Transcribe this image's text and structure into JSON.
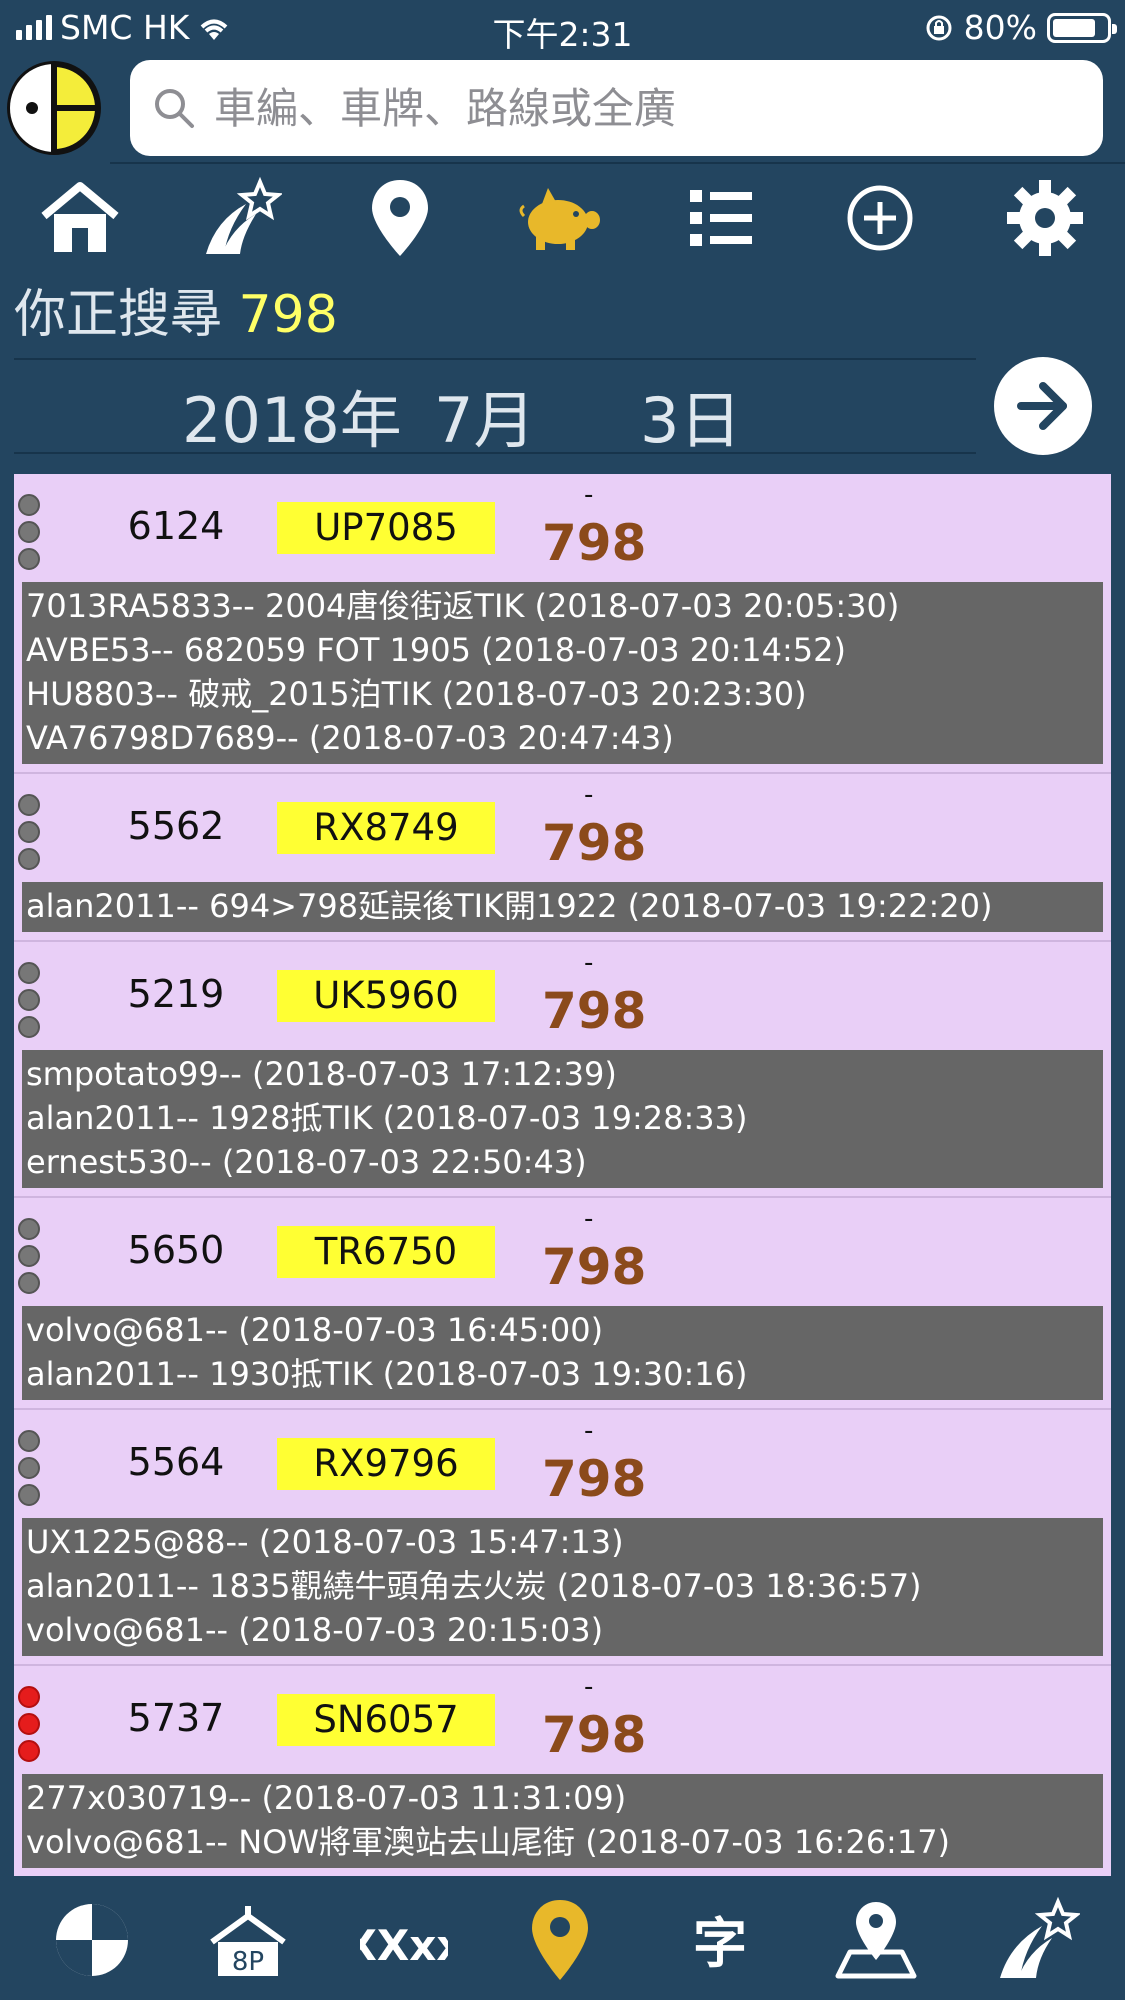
{
  "status_bar": {
    "carrier": "SMC HK",
    "time": "下午2:31",
    "battery": "80%",
    "battery_level": 0.8
  },
  "search": {
    "placeholder": "車編、車牌、路線或全廣"
  },
  "nav": {
    "icons": [
      "home-icon",
      "shooting-star-icon",
      "location-pin-icon",
      "pig-icon",
      "list-icon",
      "add-circle-icon",
      "gear-icon"
    ],
    "active": "pig-icon",
    "active_color": "#e8b82a"
  },
  "searching": {
    "label": "你正搜尋",
    "query": "798"
  },
  "date": {
    "year": "2018年",
    "month": "7月",
    "day": "3日"
  },
  "records": [
    {
      "fleet": "6124",
      "plate": "UP7085",
      "dash": "-",
      "route": "798",
      "status": "grey",
      "notes": [
        "7013RA5833-- 2004唐俊街返TIK (2018-07-03 20:05:30)",
        "AVBE53-- 682059 FOT 1905 (2018-07-03 20:14:52)",
        "HU8803-- 破戒_2015泊TIK (2018-07-03 20:23:30)",
        "VA76798D7689--  (2018-07-03 20:47:43)"
      ]
    },
    {
      "fleet": "5562",
      "plate": "RX8749",
      "dash": "-",
      "route": "798",
      "status": "grey",
      "notes": [
        "alan2011-- 694>798延誤後TIK開1922 (2018-07-03 19:22:20)"
      ]
    },
    {
      "fleet": "5219",
      "plate": "UK5960",
      "dash": "-",
      "route": "798",
      "status": "grey",
      "notes": [
        "smpotato99--  (2018-07-03 17:12:39)",
        "alan2011-- 1928抵TIK (2018-07-03 19:28:33)",
        "ernest530--  (2018-07-03 22:50:43)"
      ]
    },
    {
      "fleet": "5650",
      "plate": "TR6750",
      "dash": "-",
      "route": "798",
      "status": "grey",
      "notes": [
        "volvo@681--  (2018-07-03 16:45:00)",
        "alan2011-- 1930抵TIK (2018-07-03 19:30:16)"
      ]
    },
    {
      "fleet": "5564",
      "plate": "RX9796",
      "dash": "-",
      "route": "798",
      "status": "grey",
      "notes": [
        "UX1225@88--  (2018-07-03 15:47:13)",
        "alan2011-- 1835觀繞牛頭角去火炭 (2018-07-03 18:36:57)",
        "volvo@681--  (2018-07-03 20:15:03)"
      ]
    },
    {
      "fleet": "5737",
      "plate": "SN6057",
      "dash": "-",
      "route": "798",
      "status": "red",
      "notes": [
        "277x030719--  (2018-07-03 11:31:09)",
        "volvo@681-- NOW將軍澳站去山尾街 (2018-07-03 16:26:17)"
      ]
    },
    {
      "fleet": "",
      "plate": "",
      "dash": "-",
      "route": "",
      "status": "grey",
      "notes": []
    }
  ],
  "tabbar": {
    "icons": [
      "hk-logo-tab-icon",
      "fleet-8p-tab-icon",
      "xxxx-tab-icon",
      "location-tab-icon",
      "character-tab-icon",
      "map-pin-tab-icon",
      "shooting-star-tab-icon"
    ],
    "xxxx_label": "XXxx",
    "char_label": "字",
    "fleet_label": "8P",
    "active": "location-tab-icon",
    "active_color": "#e8b82a"
  }
}
